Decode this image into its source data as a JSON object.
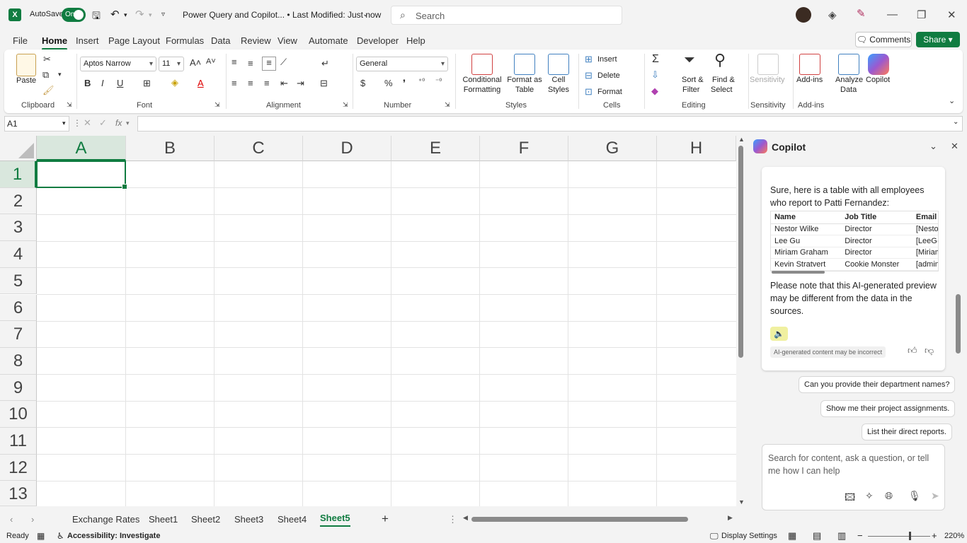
{
  "titlebar": {
    "app_logo": "X",
    "autosave_label": "AutoSave",
    "autosave_state": "On",
    "document_title": "Power Query and Copilot... • Last Modified: Just now",
    "search_placeholder": "Search",
    "min": "—",
    "max": "❐",
    "close": "✕"
  },
  "menu": {
    "items": [
      "File",
      "Home",
      "Insert",
      "Page Layout",
      "Formulas",
      "Data",
      "Review",
      "View",
      "Automate",
      "Developer",
      "Help"
    ],
    "active": "Home",
    "comments_label": "Comments",
    "share_label": "Share"
  },
  "ribbon": {
    "clipboard": {
      "label": "Clipboard",
      "paste": "Paste"
    },
    "font": {
      "label": "Font",
      "name": "Aptos Narrow",
      "size": "11"
    },
    "alignment": {
      "label": "Alignment"
    },
    "number": {
      "label": "Number",
      "format": "General"
    },
    "styles": {
      "label": "Styles",
      "conditional_1": "Conditional",
      "conditional_2": "Formatting",
      "format_table_1": "Format as",
      "format_table_2": "Table",
      "cell_styles_1": "Cell",
      "cell_styles_2": "Styles"
    },
    "cells": {
      "label": "Cells",
      "insert": "Insert",
      "delete": "Delete",
      "format": "Format"
    },
    "editing": {
      "label": "Editing",
      "sort_1": "Sort &",
      "sort_2": "Filter",
      "find_1": "Find &",
      "find_2": "Select"
    },
    "sensitivity": {
      "label": "Sensitivity",
      "button": "Sensitivity"
    },
    "addins": {
      "label": "Add-ins",
      "button": "Add-ins",
      "analyze_1": "Analyze",
      "analyze_2": "Data",
      "copilot": "Copilot"
    }
  },
  "formula_bar": {
    "name_box": "A1",
    "fx": "fx",
    "value": ""
  },
  "grid": {
    "columns": [
      "A",
      "B",
      "C",
      "D",
      "E",
      "F",
      "G",
      "H"
    ],
    "rows": [
      "1",
      "2",
      "3",
      "4",
      "5",
      "6",
      "7",
      "8",
      "9",
      "10",
      "11",
      "12",
      "13"
    ],
    "active_cell": "A1"
  },
  "sheets": {
    "tabs": [
      "Exchange Rates",
      "Sheet1",
      "Sheet2",
      "Sheet3",
      "Sheet4",
      "Sheet5"
    ],
    "active": "Sheet5",
    "add": "+"
  },
  "status": {
    "ready": "Ready",
    "accessibility": "Accessibility: Investigate",
    "display_settings": "Display Settings",
    "zoom": "220%"
  },
  "copilot": {
    "title": "Copilot",
    "intro": "Sure, here is a table with all employees who report to Patti Fernandez:",
    "table": {
      "headers": [
        "Name",
        "Job Title",
        "Email Address"
      ],
      "rows": [
        [
          "Nestor Wilke",
          "Director",
          "[NestorW@ke"
        ],
        [
          "Lee Gu",
          "Director",
          "[LeeG@kevstra"
        ],
        [
          "Miriam Graham",
          "Director",
          "[MiriamG@kev"
        ],
        [
          "Kevin Stratvert",
          "Cookie Monster",
          "[admin@kevst"
        ]
      ]
    },
    "note": "Please note that this AI-generated preview may be different from the data in the sources.",
    "ai_badge": "AI-generated content may be incorrect",
    "suggestions": [
      "Can you provide their department names?",
      "Show me their project assignments.",
      "List their direct reports."
    ],
    "input_placeholder": "Search for content, ask a question, or tell me how I can help"
  },
  "colors": {
    "accent": "#107c41"
  }
}
